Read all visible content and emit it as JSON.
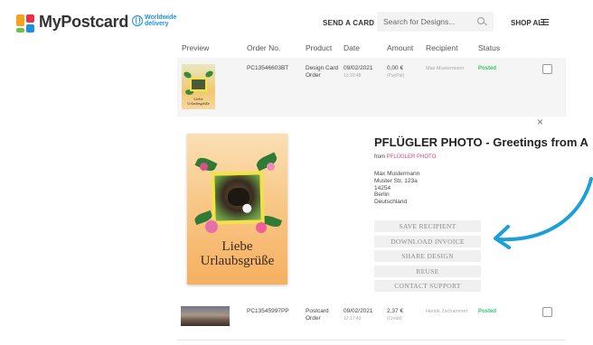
{
  "header": {
    "logo_text": "MyPostcard",
    "logo_badge_line1": "Worldwide",
    "logo_badge_line2": "delivery",
    "send_card": "SEND A CARD",
    "search_placeholder": "Search for Designs...",
    "shop_all": "SHOP ALL",
    "colors": {
      "logo_orange": "#f7a21b",
      "logo_red": "#e8304d",
      "logo_blue": "#1d8fe1",
      "logo_green": "#6cc24a"
    }
  },
  "columns": [
    "Preview",
    "Order No.",
    "Product",
    "Date",
    "Amount",
    "Recipient",
    "Status"
  ],
  "orders": [
    {
      "order_no": "PC13546603BT",
      "product": "Design Card Order",
      "product_line1": "Design Card",
      "product_line2": "Order",
      "date": "09/02/2021",
      "time": "13:20:48",
      "amount": "0,00 €",
      "payment": "(PayPal)",
      "recipient": "Max Mustermann",
      "status": "Posted"
    },
    {
      "order_no": "PC13545997PP",
      "product_line1": "Postcard",
      "product_line2": "Order",
      "date": "09/02/2021",
      "time": "12:17:43",
      "amount": "2,37 €",
      "payment": "(Credit)",
      "recipient": "Henrik Zschammer",
      "status": "Posted"
    }
  ],
  "thumb_label_line1": "Liebe",
  "thumb_label_line2": "Urlaubsgrüße",
  "detail": {
    "close": "×",
    "title": "PFLÜGLER PHOTO - Greetings from A",
    "from_label": "from",
    "from_brand": "PFLÜGLER PHOTO",
    "address": [
      "Max Mustermann",
      "Muster Str. 123a",
      "14254",
      "Berlin",
      "Deutschland"
    ],
    "card_text_line1": "Liebe",
    "card_text_line2": "Urlaubsgrüße",
    "actions": [
      "SAVE RECIPIENT",
      "DOWNLOAD INVOICE",
      "SHARE DESIGN",
      "REUSE",
      "CONTACT SUPPORT"
    ],
    "arrow_color": "#1a9fd8"
  }
}
